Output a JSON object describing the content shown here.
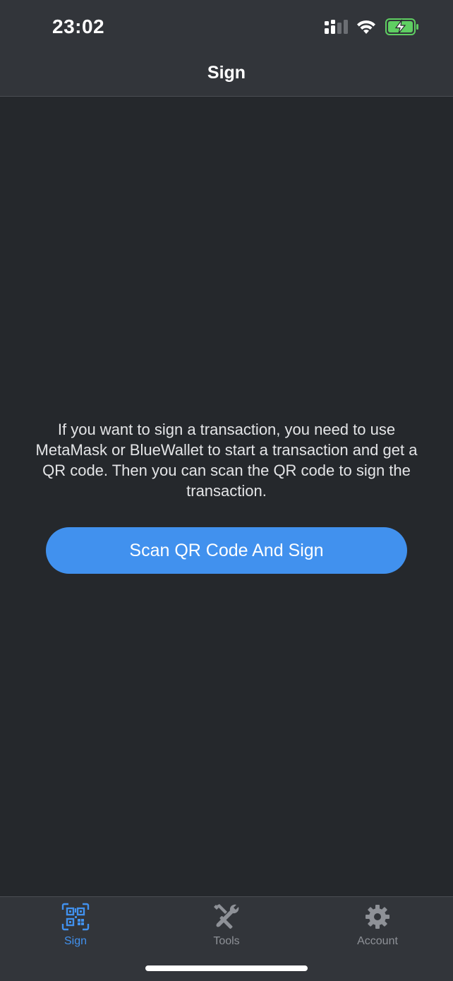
{
  "status_bar": {
    "time": "23:02",
    "icons": [
      "signal-icon",
      "wifi-icon",
      "battery-charging-icon"
    ],
    "battery_color": "#5fce62"
  },
  "nav": {
    "title": "Sign"
  },
  "main": {
    "message": "If you want to sign a transaction, you need to use MetaMask or BlueWallet to start a transaction and get a QR code. Then you can scan the QR code to sign the transaction.",
    "scan_button_label": "Scan QR Code And Sign"
  },
  "tab_bar": {
    "tabs": [
      {
        "label": "Sign",
        "icon": "qr-code-icon",
        "active": true
      },
      {
        "label": "Tools",
        "icon": "tools-icon",
        "active": false
      },
      {
        "label": "Account",
        "icon": "gear-icon",
        "active": false
      }
    ]
  },
  "colors": {
    "accent": "#4191ee",
    "background": "#25282c",
    "bars": "#32353a",
    "inactive_tab": "#8e9197"
  }
}
